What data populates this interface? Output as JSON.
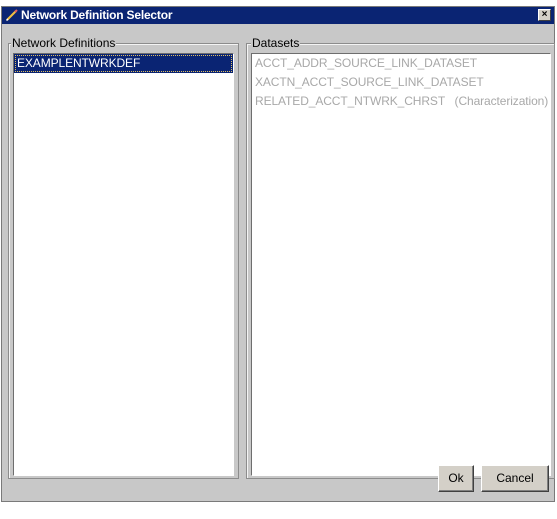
{
  "window": {
    "title": "Network Definition Selector",
    "close_symbol": "×"
  },
  "left_panel": {
    "legend": "Network Definitions",
    "items": [
      {
        "label": "EXAMPLENTWRKDEF",
        "selected": true
      }
    ]
  },
  "right_panel": {
    "legend": "Datasets",
    "items": [
      {
        "label": "ACCT_ADDR_SOURCE_LINK_DATASET"
      },
      {
        "label": "XACTN_ACCT_SOURCE_LINK_DATASET"
      },
      {
        "label": "RELATED_ACCT_NTWRK_CHRST   (Characterization)"
      }
    ]
  },
  "buttons": {
    "ok_label": "Ok",
    "cancel_label": "Cancel"
  },
  "colors": {
    "titlebar": "#0a2473",
    "selection": "#0a2473",
    "disabled_text": "#a8a8a8",
    "dialog_bg": "#c8c8c8"
  },
  "icons": {
    "title_icon": "pencil-icon",
    "close_icon": "close-icon"
  }
}
